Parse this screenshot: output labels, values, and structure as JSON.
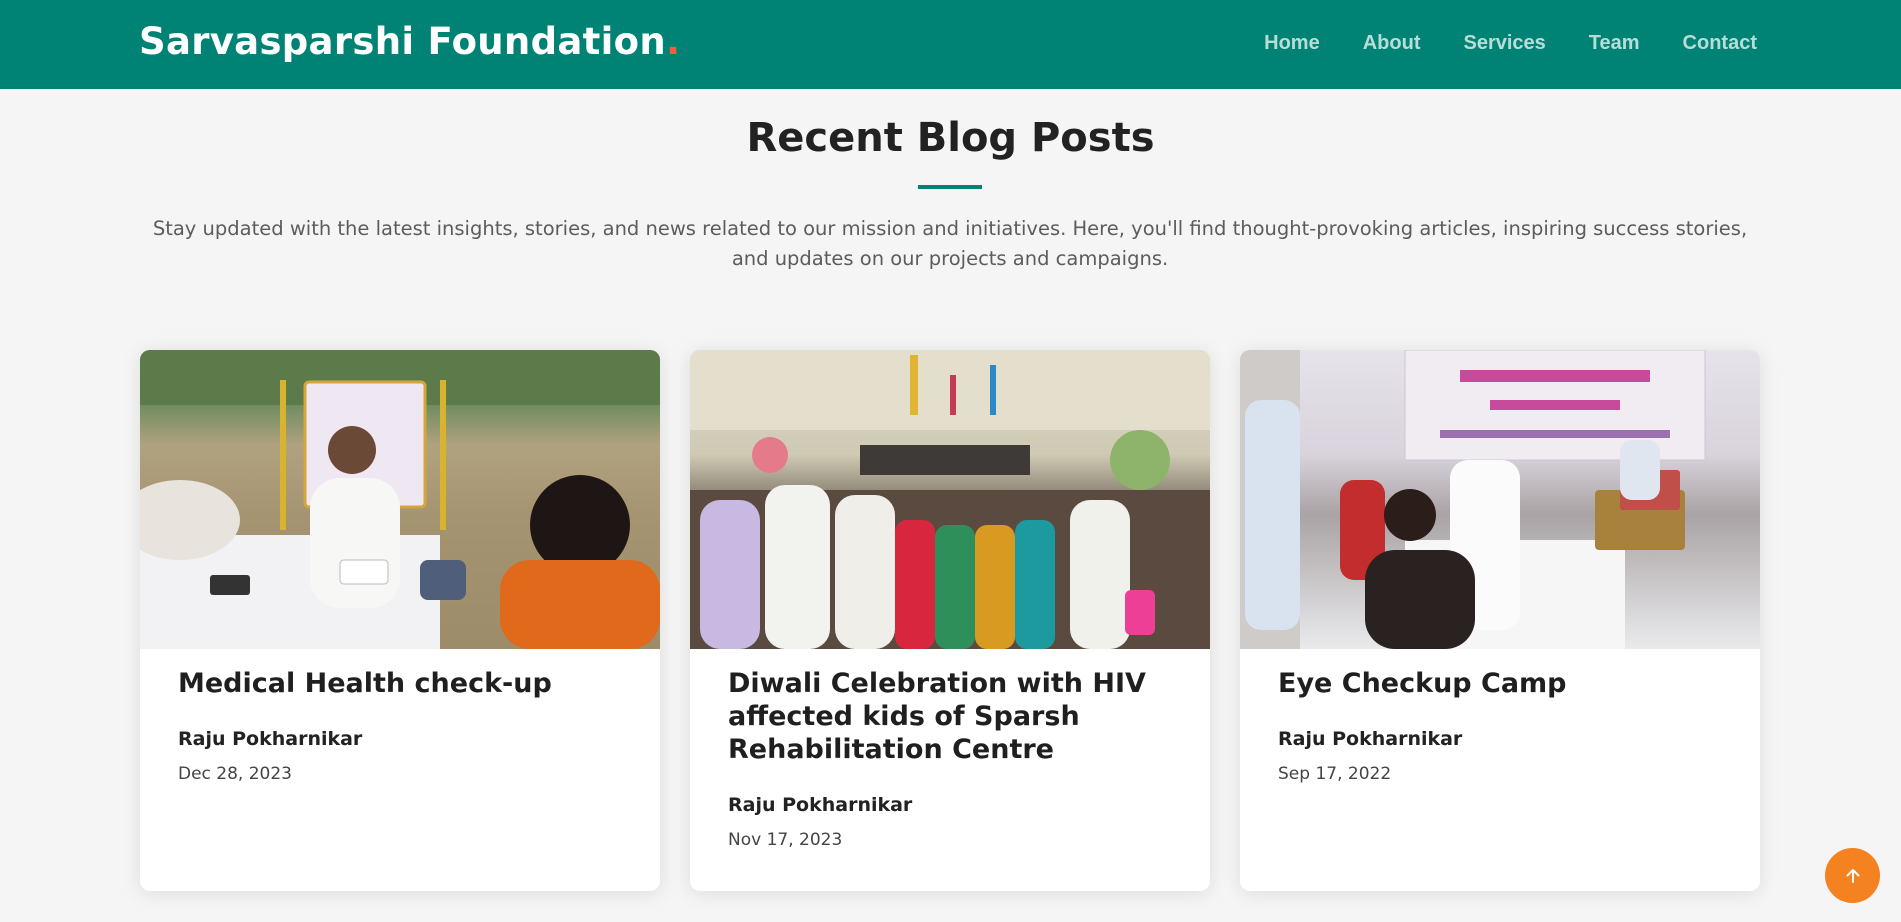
{
  "header": {
    "brand": "Sarvasparshi Foundation",
    "brand_dot": ".",
    "nav": [
      "Home",
      "About",
      "Services",
      "Team",
      "Contact"
    ]
  },
  "section": {
    "title": "Recent Blog Posts",
    "intro": "Stay updated with the latest insights, stories, and news related to our mission and initiatives. Here, you'll find thought-provoking articles, inspiring success stories, and updates on our projects and campaigns."
  },
  "posts": [
    {
      "title": "Medical Health check-up",
      "author": "Raju Pokharnikar",
      "date": "Dec 28, 2023",
      "image_label": "medical-checkup-photo"
    },
    {
      "title": "Diwali Celebration with HIV affected kids of Sparsh Rehabilitation Centre",
      "author": "Raju Pokharnikar",
      "date": "Nov 17, 2023",
      "image_label": "diwali-celebration-photo"
    },
    {
      "title": "Eye Checkup Camp",
      "author": "Raju Pokharnikar",
      "date": "Sep 17, 2022",
      "image_label": "eye-checkup-photo"
    }
  ],
  "colors": {
    "header_bg": "#008374",
    "accent": "#f85a40",
    "scroll_top_bg": "#f58220",
    "page_bg": "#f5f5f5"
  },
  "icons": {
    "scroll_top": "arrow-up-icon"
  }
}
